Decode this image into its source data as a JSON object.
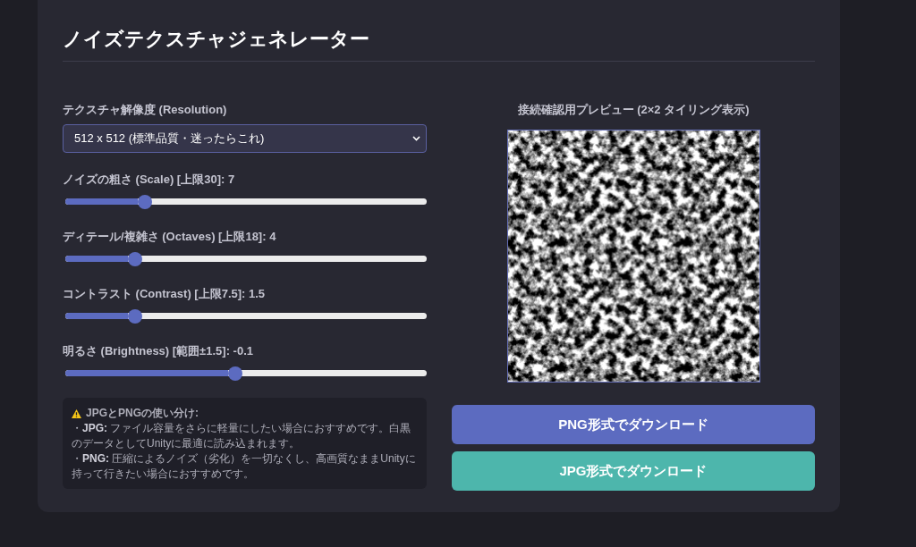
{
  "title": "ノイズテクスチャジェネレーター",
  "resolution": {
    "label": "テクスチャ解像度 (Resolution)",
    "value": "512 x 512 (標準品質・迷ったらこれ)"
  },
  "sliders": [
    {
      "label": "ノイズの粗さ (Scale) [上限30]: 7",
      "level": 0.21
    },
    {
      "label": "ディテール/複雑さ (Octaves) [上限18]: 4",
      "level": 0.18
    },
    {
      "label": "コントラスト (Contrast) [上限7.5]: 1.5",
      "level": 0.18
    },
    {
      "label": "明るさ (Brightness) [範囲±1.5]: -0.1",
      "level": 0.47
    }
  ],
  "note": {
    "heading": "JPGとPNGの使い分け:",
    "items": [
      "・**JPG:** ファイル容量をさらに軽量にしたい場合におすすめです。白黒のデータとしてUnityに最適に読み込まれます。",
      "・**PNG:** 圧縮によるノイズ（劣化）を一切なくし、高画質なままUnityに持って行きたい場合におすすめです。"
    ]
  },
  "preview": {
    "label": "接続確認用プレビュー (2×2 タイリング表示)"
  },
  "buttons": [
    {
      "label": "PNG形式でダウンロード",
      "color": "#5c6bc0"
    },
    {
      "label": "JPG形式でダウンロード",
      "color": "#4db6ac"
    }
  ]
}
